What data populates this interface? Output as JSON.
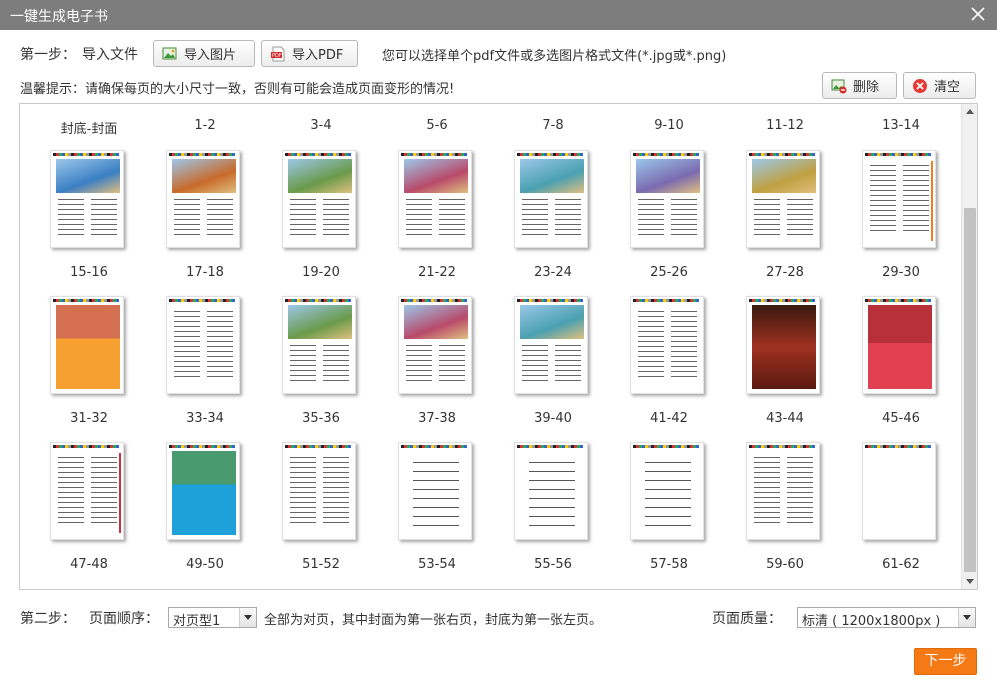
{
  "window": {
    "title": "一键生成电子书"
  },
  "icons": {
    "close": "close-icon",
    "import_image": "image-icon",
    "import_pdf": "pdf-icon",
    "delete": "image-delete-icon",
    "clear": "clear-icon"
  },
  "colors": {
    "accent": "#f57a16",
    "titlebar": "#7d7d7d",
    "clear_icon": "#e53935"
  },
  "step1": {
    "label": "第一步：",
    "action": "导入文件",
    "import_image": "导入图片",
    "import_pdf": "导入PDF",
    "format_hint": "您可以选择单个pdf文件或多选图片格式文件(*.jpg或*.png)",
    "tip": "温馨提示：请确保每页的大小尺寸一致，否则有可能会造成页面变形的情况!",
    "delete": "删除",
    "clear": "清空"
  },
  "gallery": {
    "top_labels": [
      "封底-封面",
      "1-2",
      "3-4",
      "5-6",
      "7-8",
      "9-10",
      "11-12",
      "13-14"
    ],
    "rows": [
      {
        "pages": [
          {
            "label": "15-16",
            "kind": "photo-text"
          },
          {
            "label": "17-18",
            "kind": "photo-text"
          },
          {
            "label": "19-20",
            "kind": "photo-text"
          },
          {
            "label": "21-22",
            "kind": "photo-text"
          },
          {
            "label": "23-24",
            "kind": "photo-text"
          },
          {
            "label": "25-26",
            "kind": "photo-text"
          },
          {
            "label": "27-28",
            "kind": "photo-text"
          },
          {
            "label": "29-30",
            "kind": "text"
          }
        ]
      },
      {
        "pages": [
          {
            "label": "31-32",
            "kind": "orange"
          },
          {
            "label": "33-34",
            "kind": "text"
          },
          {
            "label": "35-36",
            "kind": "photo-text"
          },
          {
            "label": "37-38",
            "kind": "photo-text"
          },
          {
            "label": "39-40",
            "kind": "photo-text"
          },
          {
            "label": "41-42",
            "kind": "text"
          },
          {
            "label": "43-44",
            "kind": "dark"
          },
          {
            "label": "45-46",
            "kind": "red"
          }
        ]
      },
      {
        "pages": [
          {
            "label": "47-48",
            "kind": "text"
          },
          {
            "label": "49-50",
            "kind": "blue"
          },
          {
            "label": "51-52",
            "kind": "text"
          },
          {
            "label": "53-54",
            "kind": "lines"
          },
          {
            "label": "55-56",
            "kind": "lines"
          },
          {
            "label": "57-58",
            "kind": "lines"
          },
          {
            "label": "59-60",
            "kind": "text"
          },
          {
            "label": "61-62",
            "kind": "blank"
          }
        ]
      }
    ]
  },
  "step2": {
    "label": "第二步：",
    "order_label": "页面顺序：",
    "order_value": "对页型1",
    "order_desc": "全部为对页，其中封面为第一张右页，封底为第一张左页。",
    "quality_label": "页面质量：",
    "quality_value": "标清 ( 1200x1800px )"
  },
  "next_button": "下一步"
}
